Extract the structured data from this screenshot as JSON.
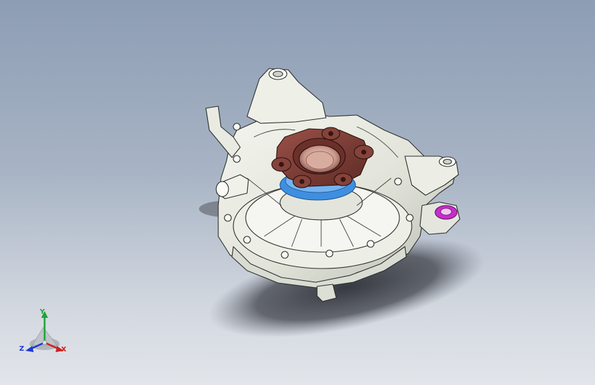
{
  "viewport": {
    "background_top": "#8d9db4",
    "background_bottom": "#e2e5ea"
  },
  "model": {
    "housing_color": "#e6e8df",
    "flange_color": "#7a3a33",
    "seal_color": "#3f8fe0",
    "mount_highlight_color": "#c62ec9",
    "shadow_color": "#2e3138"
  },
  "triad": {
    "x_label": "X",
    "y_label": "Y",
    "z_label": "Z",
    "x_color": "#d21f1f",
    "y_color": "#1fa33a",
    "z_color": "#1f3ad2"
  }
}
